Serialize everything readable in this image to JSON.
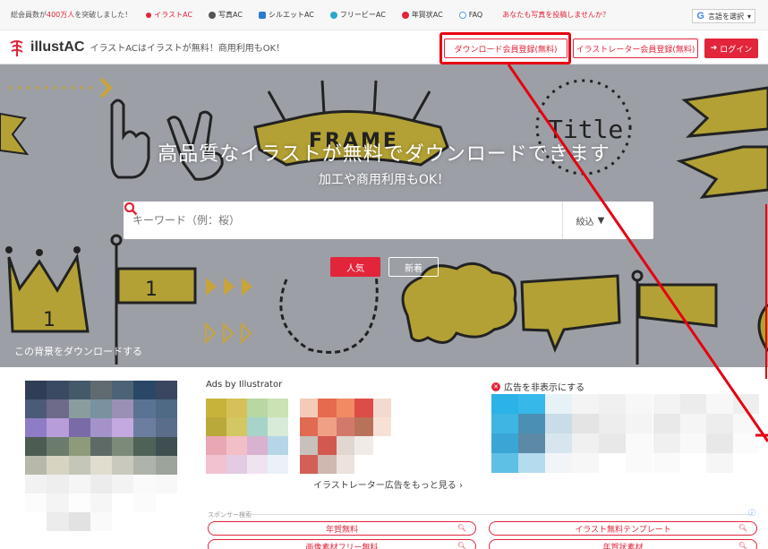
{
  "topbar": {
    "notice_prefix": "総会員数が",
    "notice_count": "400万人",
    "notice_suffix": "を突破しました！",
    "links": [
      {
        "label": "イラストAC",
        "color": "#e2253b",
        "icon": "illust-ac-icon"
      },
      {
        "label": "写真AC",
        "color": "#555555",
        "icon": "photo-ac-icon"
      },
      {
        "label": "シルエットAC",
        "color": "#2b7bd6",
        "icon": "silhouette-ac-icon"
      },
      {
        "label": "フリービーAC",
        "color": "#2aa8c9",
        "icon": "freebie-ac-icon"
      },
      {
        "label": "年賀状AC",
        "color": "#e2253b",
        "icon": "nenga-ac-icon"
      },
      {
        "label": "FAQ",
        "color": "#5aa0e0",
        "icon": "faq-icon"
      }
    ],
    "cta": "あなたも写真を投稿しませんか？",
    "lang_label": "言語を選択"
  },
  "header": {
    "logo": "illustAC",
    "tagline": "イラストACはイラストが無料！商用利用もOK！",
    "download_signup": "ダウンロード会員登録(無料)",
    "illustrator_signup": "イラストレーター会員登録(無料)",
    "login": "ログイン"
  },
  "hero": {
    "title": "高品質なイラストが無料でダウンロードできます",
    "subtitle": "加工や商用利用もOK！",
    "search_placeholder": "キーワード（例：桜）",
    "filter_label": "絞込",
    "tab_popular": "人気",
    "tab_new": "新着",
    "bg_download": "この背景をダウンロードする",
    "frame_text": "FRAME",
    "title_text": "Title",
    "flag_number": "1",
    "crown_number": "1"
  },
  "ads": {
    "label": "Ads by Illustrator",
    "hide_label": "広告を非表示にする",
    "more_label": "イラストレーター広告をもっと見る ›"
  },
  "sponsor": {
    "label": "スポンサー検索",
    "links": [
      "年賀無料",
      "イラスト無料テンプレート",
      "画像素材フリー無料",
      "年賀状素材"
    ]
  },
  "colors": {
    "brand_red": "#e2253b",
    "hero_bg": "#9c9fa5",
    "olive": "#b3a135",
    "highlight": "#e60012"
  }
}
